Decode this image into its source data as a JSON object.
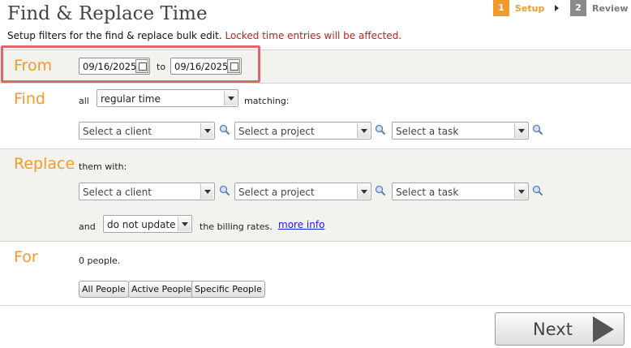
{
  "page": {
    "title": "Find & Replace Time",
    "subtitle": "Setup filters for the find & replace bulk edit.",
    "warning": "Locked time entries will be affected."
  },
  "steps": [
    {
      "num": "1",
      "label": "Setup",
      "active": true
    },
    {
      "num": "2",
      "label": "Review",
      "active": false
    }
  ],
  "colors": {
    "accent": "#f39a2c",
    "step_active": "#f39a2c",
    "step_inactive": "#8a8a8a",
    "warning": "#c0211f",
    "link": "#1a1ae6"
  },
  "from": {
    "label": "From",
    "start_date": "09/16/2025",
    "to_label": "to",
    "end_date": "09/16/2025"
  },
  "find": {
    "label": "Find",
    "prefix": "all",
    "type_value": "regular time",
    "suffix": "matching:",
    "client_placeholder": "Select a client",
    "project_placeholder": "Select a project",
    "task_placeholder": "Select a task"
  },
  "replace": {
    "label": "Replace",
    "intro": "them with:",
    "client_placeholder": "Select a client",
    "project_placeholder": "Select a project",
    "task_placeholder": "Select a task",
    "and_label": "and",
    "billing_value": "do not update",
    "billing_suffix": "the billing rates.",
    "more_info": "more info"
  },
  "for": {
    "label": "For",
    "count_text": "0 people.",
    "buttons": [
      "All People",
      "Active People",
      "Specific People"
    ]
  },
  "footer": {
    "next_label": "Next"
  },
  "icons": {
    "search": "magnifier-icon",
    "calendar": "calendar-icon",
    "next": "play-arrow-icon"
  }
}
